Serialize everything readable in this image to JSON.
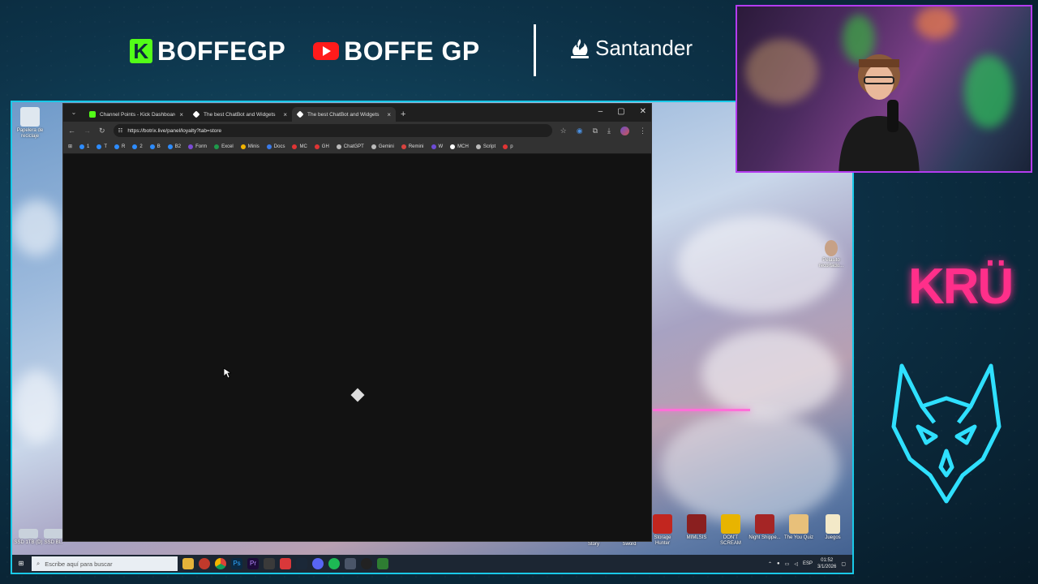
{
  "banner": {
    "kick_logo": "K",
    "kick_handle": "BOFFEGP",
    "youtube_handle": "BOFFE GP",
    "sponsor": "Santander"
  },
  "desktop": {
    "icons_left": [
      {
        "label": "Papelera de reciclaje"
      },
      {
        "label": "SSD 1TB (D)"
      },
      {
        "label": "SSD Bl.."
      }
    ],
    "icon_right": {
      "label": "Pelasito recortado..."
    },
    "icons_bottom": [
      {
        "label": "Storage Hunter"
      },
      {
        "label": "MIMLSIS"
      },
      {
        "label": "DON'T SCREAM"
      },
      {
        "label": "Night Shippe..."
      },
      {
        "label": "The You Quiz"
      },
      {
        "label": "Juegos"
      }
    ],
    "icons_bottom_small": [
      "Story",
      "Sword"
    ]
  },
  "browser": {
    "tabs": [
      {
        "title": "Channel Points - Kick Dashboard",
        "color": "#53fc18",
        "active": false
      },
      {
        "title": "The best ChatBot and Widgets",
        "color": "#ffffff",
        "active": false
      },
      {
        "title": "The best ChatBot and Widgets",
        "color": "#ffffff",
        "active": true
      }
    ],
    "new_tab": "+",
    "url": "https://botrix.live/panel/loyalty?tab=store",
    "bookmarks": [
      {
        "label": "1",
        "color": "#2d8cff"
      },
      {
        "label": "T",
        "color": "#2d8cff"
      },
      {
        "label": "R",
        "color": "#2d8cff"
      },
      {
        "label": "2",
        "color": "#2d8cff"
      },
      {
        "label": "B",
        "color": "#2d8cff"
      },
      {
        "label": "B2",
        "color": "#2d8cff"
      },
      {
        "label": "Form",
        "color": "#7b4bd6"
      },
      {
        "label": "Excel",
        "color": "#1e9a4b"
      },
      {
        "label": "Minis",
        "color": "#f2b400"
      },
      {
        "label": "Docs",
        "color": "#3a7bea"
      },
      {
        "label": "MC",
        "color": "#e03434"
      },
      {
        "label": "GH",
        "color": "#e03434"
      },
      {
        "label": "ChatGPT",
        "color": "#bbbbbb"
      },
      {
        "label": "Gemini",
        "color": "#bbbbbb"
      },
      {
        "label": "Remini",
        "color": "#d9433f"
      },
      {
        "label": "W",
        "color": "#6d4bd6"
      },
      {
        "label": "MCH",
        "color": "#ffffff"
      },
      {
        "label": "Script",
        "color": "#bbbbbb"
      },
      {
        "label": "p",
        "color": "#e03434"
      }
    ]
  },
  "taskbar": {
    "search_placeholder": "Escribe aquí para buscar",
    "language": "ESP",
    "time": "01:52",
    "date": "3/1/2026"
  },
  "sidebar_logo": "KRÜ"
}
